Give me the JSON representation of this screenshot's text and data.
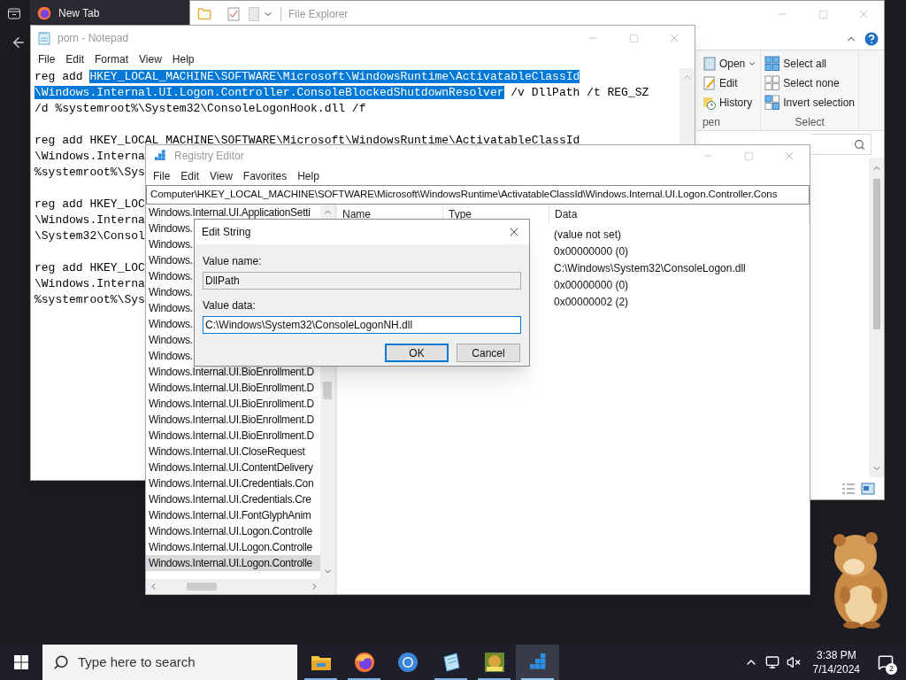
{
  "browser": {
    "tab_title": "New Tab"
  },
  "file_explorer": {
    "title": "File Explorer",
    "ribbon_groups": [
      {
        "label": "pen",
        "items": [
          {
            "label": "Open",
            "dropdown": true
          },
          {
            "label": "Edit",
            "dropdown": false
          },
          {
            "label": "History",
            "dropdown": false
          }
        ]
      },
      {
        "label": "Select",
        "items": [
          {
            "label": "Select all",
            "dropdown": false
          },
          {
            "label": "Select none",
            "dropdown": false
          },
          {
            "label": "Invert selection",
            "dropdown": false
          }
        ]
      }
    ]
  },
  "notepad": {
    "title": "porn - Notepad",
    "menu": [
      "File",
      "Edit",
      "Format",
      "View",
      "Help"
    ],
    "blocks": [
      {
        "lines": [
          [
            {
              "text": "reg add ",
              "selected": false
            },
            {
              "text": "HKEY_LOCAL_MACHINE\\SOFTWARE\\Microsoft\\WindowsRuntime\\ActivatableClassId",
              "selected": true
            }
          ],
          [
            {
              "text": "\\Windows.Internal.UI.Logon.Controller.ConsoleBlockedShutdownResolver",
              "selected": true
            },
            {
              "text": " /v DllPath /t REG_SZ",
              "selected": false
            }
          ],
          [
            {
              "text": "/d %systemroot%\\System32\\ConsoleLogonHook.dll /f",
              "selected": false
            }
          ]
        ]
      },
      {
        "lines": [
          [
            {
              "text": "reg add HKEY_LOCAL_MACHINE\\SOFTWARE\\Microsoft\\WindowsRuntime\\ActivatableClassId",
              "selected": false
            }
          ],
          [
            {
              "text": "\\Windows.Interna",
              "selected": false
            }
          ],
          [
            {
              "text": "%systemroot%\\Sys",
              "selected": false
            }
          ]
        ]
      },
      {
        "lines": [
          [
            {
              "text": "reg add HKEY_LOC",
              "selected": false
            }
          ],
          [
            {
              "text": "\\Windows.Interna",
              "selected": false
            }
          ],
          [
            {
              "text": "\\System32\\Consol",
              "selected": false
            }
          ]
        ]
      },
      {
        "lines": [
          [
            {
              "text": "reg add HKEY_LOC",
              "selected": false
            }
          ],
          [
            {
              "text": "\\Windows.Interna",
              "selected": false
            }
          ],
          [
            {
              "text": "%systemroot%\\Sys",
              "selected": false
            }
          ]
        ]
      }
    ]
  },
  "registry_editor": {
    "title": "Registry Editor",
    "menu": [
      "File",
      "Edit",
      "View",
      "Favorites",
      "Help"
    ],
    "address": "Computer\\HKEY_LOCAL_MACHINE\\SOFTWARE\\Microsoft\\WindowsRuntime\\ActivatableClassId\\Windows.Internal.UI.Logon.Controller.Cons",
    "tree": [
      {
        "label": "Windows.Internal.UI.ApplicationSetti",
        "selected": false
      },
      {
        "label": "Windows.",
        "selected": false
      },
      {
        "label": "Windows.",
        "selected": false
      },
      {
        "label": "Windows.",
        "selected": false
      },
      {
        "label": "Windows.",
        "selected": false
      },
      {
        "label": "Windows.",
        "selected": false
      },
      {
        "label": "Windows.",
        "selected": false
      },
      {
        "label": "Windows.",
        "selected": false
      },
      {
        "label": "Windows.",
        "selected": false
      },
      {
        "label": "Windows.",
        "selected": false
      },
      {
        "label": "Windows.Internal.UI.BioEnrollment.D",
        "selected": false
      },
      {
        "label": "Windows.Internal.UI.BioEnrollment.D",
        "selected": false
      },
      {
        "label": "Windows.Internal.UI.BioEnrollment.D",
        "selected": false
      },
      {
        "label": "Windows.Internal.UI.BioEnrollment.D",
        "selected": false
      },
      {
        "label": "Windows.Internal.UI.BioEnrollment.D",
        "selected": false
      },
      {
        "label": "Windows.Internal.UI.CloseRequest",
        "selected": false
      },
      {
        "label": "Windows.Internal.UI.ContentDelivery",
        "selected": false
      },
      {
        "label": "Windows.Internal.UI.Credentials.Con",
        "selected": false
      },
      {
        "label": "Windows.Internal.UI.Credentials.Cre",
        "selected": false
      },
      {
        "label": "Windows.Internal.UI.FontGlyphAnim",
        "selected": false
      },
      {
        "label": "Windows.Internal.UI.Logon.Controlle",
        "selected": false
      },
      {
        "label": "Windows.Internal.UI.Logon.Controlle",
        "selected": false
      },
      {
        "label": "Windows.Internal.UI.Logon.Controlle",
        "selected": true
      }
    ],
    "columns": [
      "Name",
      "Type",
      "Data"
    ],
    "rows": [
      {
        "data": "(value not set)"
      },
      {
        "data": "0x00000000 (0)"
      },
      {
        "data": "C:\\Windows\\System32\\ConsoleLogon.dll"
      },
      {
        "data": "0x00000000 (0)"
      },
      {
        "data": "0x00000002 (2)"
      }
    ]
  },
  "dialog": {
    "title": "Edit String",
    "value_name_label": "Value name:",
    "value_name": "DllPath",
    "value_data_label": "Value data:",
    "value_data": "C:\\Windows\\System32\\ConsoleLogonNH.dll",
    "buttons": [
      "OK",
      "Cancel"
    ]
  },
  "taskbar": {
    "search_placeholder": "Type here to search",
    "apps": [
      {
        "selected": false,
        "running": true
      },
      {
        "selected": false,
        "running": true
      },
      {
        "selected": false,
        "running": false
      },
      {
        "selected": false,
        "running": true
      },
      {
        "selected": false,
        "running": true
      },
      {
        "selected": true,
        "running": true
      }
    ],
    "time": "3:38 PM",
    "date": "7/14/2024",
    "notification_count": "2"
  }
}
